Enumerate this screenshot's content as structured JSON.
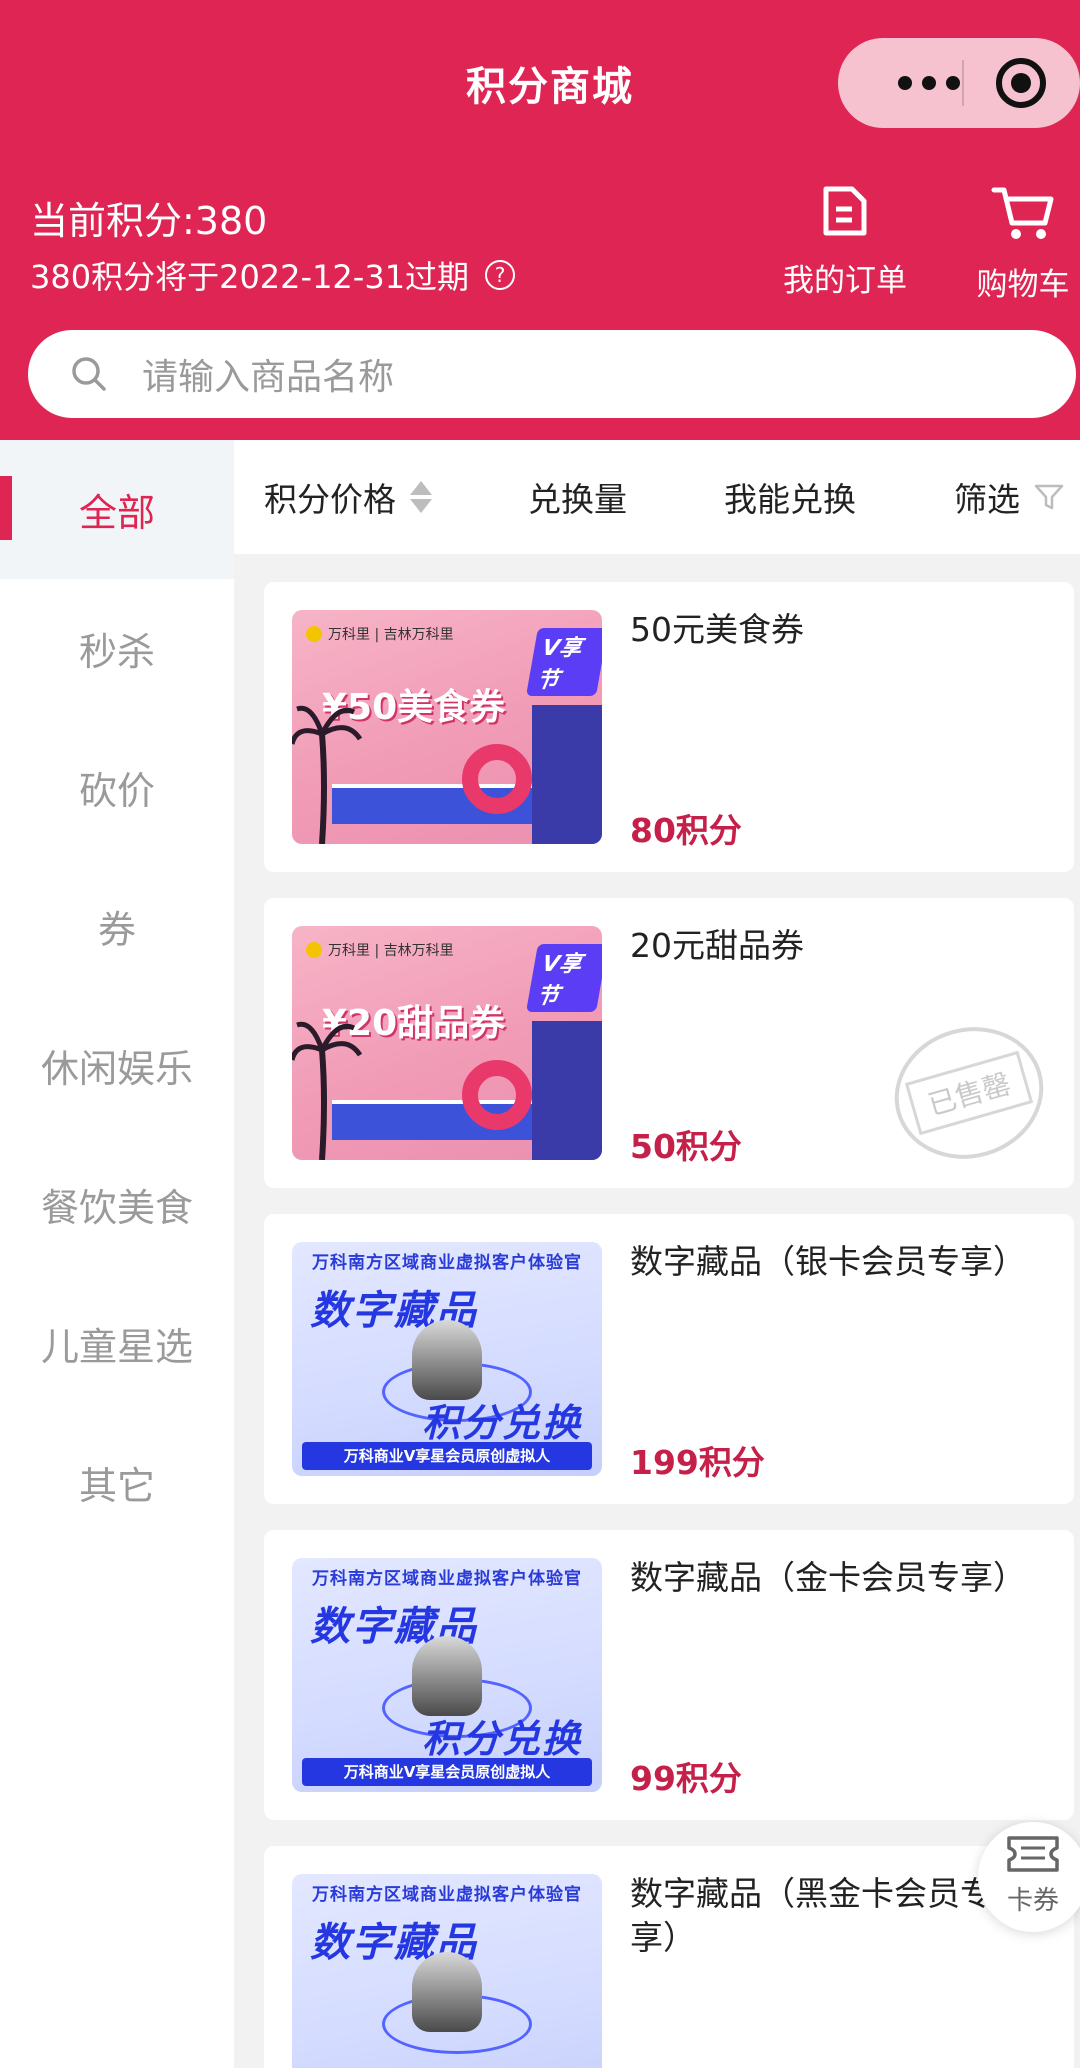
{
  "header": {
    "title": "积分商城",
    "points_label": "当前积分:380",
    "expire_text": "380积分将于2022-12-31过期",
    "help_symbol": "?",
    "orders_label": "我的订单",
    "cart_label": "购物车",
    "brand_color": "#de2553"
  },
  "search": {
    "placeholder": "请输入商品名称"
  },
  "sidebar": {
    "items": [
      {
        "label": "全部",
        "active": true
      },
      {
        "label": "秒杀"
      },
      {
        "label": "砍价"
      },
      {
        "label": "券"
      },
      {
        "label": "休闲娱乐"
      },
      {
        "label": "餐饮美食"
      },
      {
        "label": "儿童星选"
      },
      {
        "label": "其它"
      }
    ]
  },
  "sort_bar": {
    "price": "积分价格",
    "volume": "兑换量",
    "can_redeem": "我能兑换",
    "filter": "筛选"
  },
  "products": [
    {
      "name": "50元美食券",
      "price": "80积分",
      "coupon_text": "¥50美食券",
      "brand": "万科里 | 吉林万科里",
      "tag": "V享节"
    },
    {
      "name": "20元甜品券",
      "price": "50积分",
      "coupon_text": "¥20甜品券",
      "brand": "万科里 | 吉林万科里",
      "tag": "V享节",
      "sold_out": "已售罄"
    },
    {
      "name": "数字藏品（银卡会员专享）",
      "price": "199积分",
      "head": "万科南方区域商业虚拟客户体验官",
      "big1": "数字藏品",
      "big2": "积分兑换",
      "foot": "万科商业V享星会员原创虚拟人"
    },
    {
      "name": "数字藏品（金卡会员专享）",
      "price": "99积分",
      "head": "万科南方区域商业虚拟客户体验官",
      "big1": "数字藏品",
      "big2": "积分兑换",
      "foot": "万科商业V享星会员原创虚拟人"
    },
    {
      "name": "数字藏品（黑金卡会员专享）",
      "head": "万科南方区域商业虚拟客户体验官",
      "big1": "数字藏品"
    }
  ],
  "float_button": {
    "label": "卡券"
  }
}
